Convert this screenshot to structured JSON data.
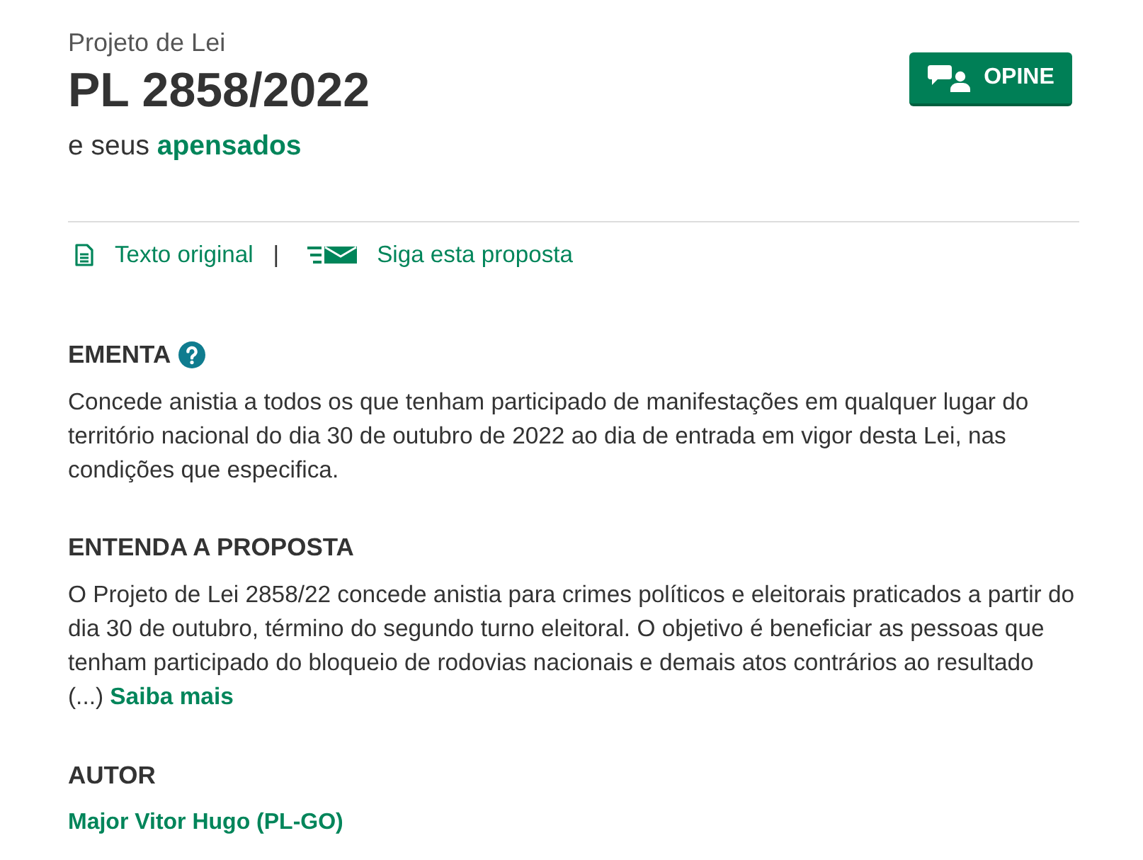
{
  "header": {
    "kind_label": "Projeto de Lei",
    "title": "PL 2858/2022",
    "subtitle": {
      "text": "e seus",
      "link": "apensados"
    }
  },
  "opine_button": {
    "label": "OPINE"
  },
  "links": [
    {
      "kind": "document",
      "label": "Texto original"
    },
    {
      "kind": "follow",
      "label": "Siga esta proposta"
    }
  ],
  "link_separator": "|",
  "sections": [
    {
      "kind": "summary",
      "heading": "EMENTA",
      "help": true,
      "text": "Concede anistia a todos os que tenham participado de manifestações em qualquer lugar do território nacional do dia 30 de outubro de 2022 ao dia de entrada em vigor desta Lei, nas condições que especifica."
    },
    {
      "kind": "summary",
      "heading": "ENTENDA A PROPOSTA",
      "text": "O Projeto de Lei 2858/22 concede anistia para crimes políticos e eleitorais praticados a partir do dia 30 de outubro, término do segundo turno eleitoral. O objetivo é beneficiar as pessoas que tenham participado do bloqueio de rodovias nacionais e demais atos contrários ao resultado (...)",
      "more_link": "Saiba mais"
    },
    {
      "kind": "author",
      "heading": "AUTOR",
      "author_link": "Major Vitor Hugo (PL-GO)"
    }
  ]
}
